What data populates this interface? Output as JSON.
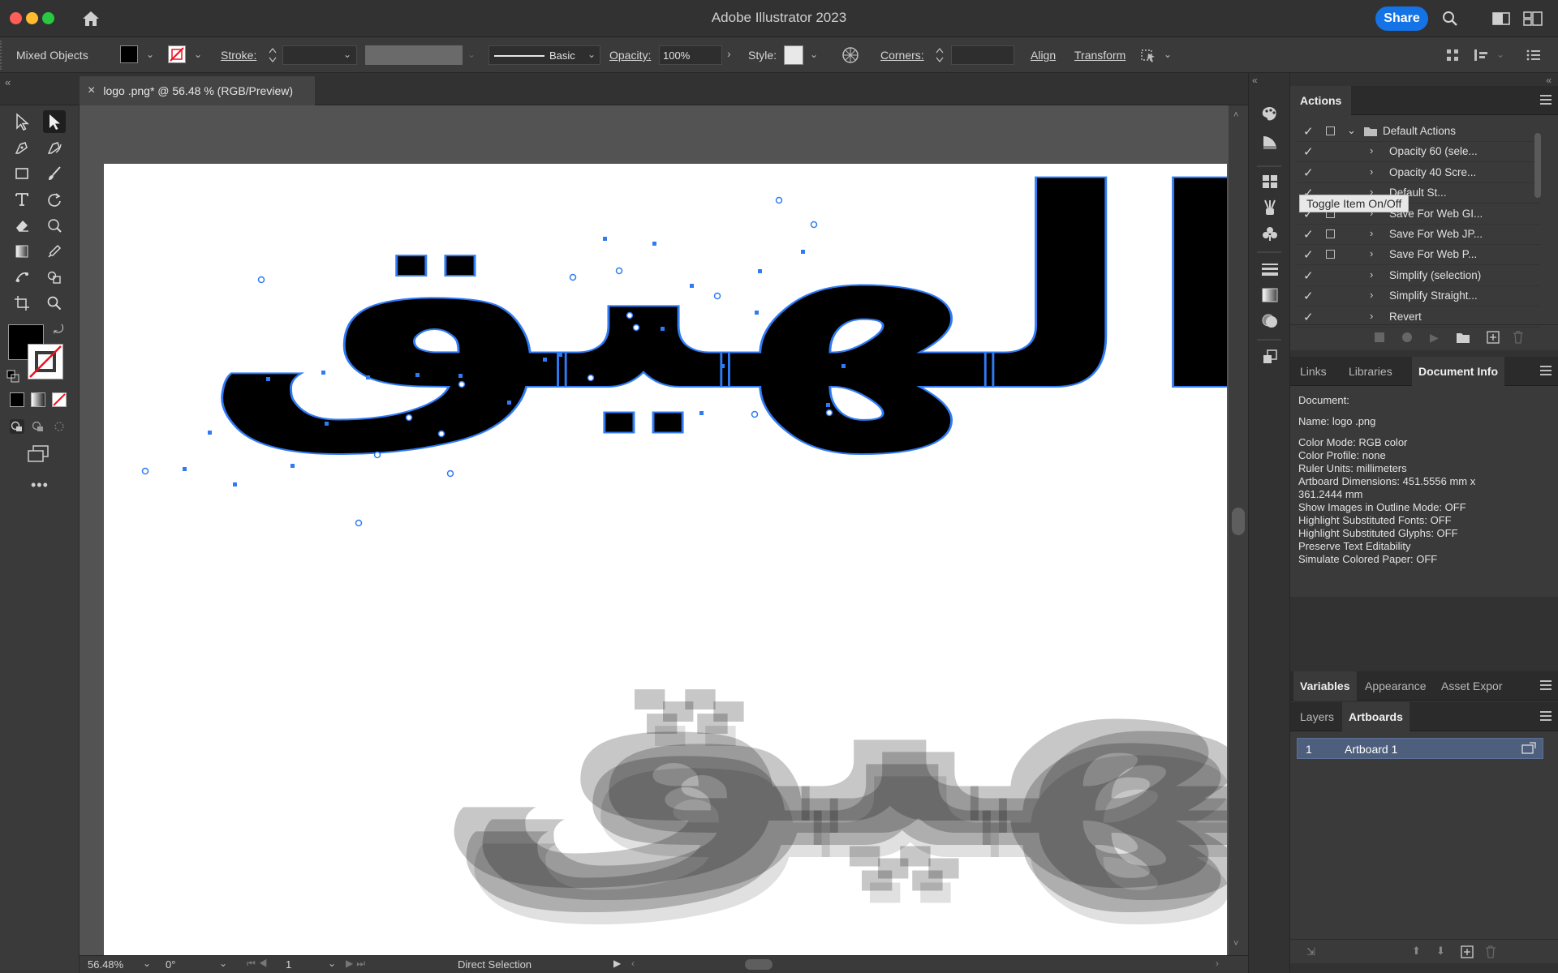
{
  "app": {
    "title": "Adobe Illustrator 2023",
    "share_label": "Share"
  },
  "control_bar": {
    "selection_label": "Mixed Objects",
    "stroke_label": "Stroke:",
    "stroke_profile": "Basic",
    "opacity_label": "Opacity:",
    "opacity_value": "100%",
    "style_label": "Style:",
    "corners_label": "Corners:",
    "align_label": "Align",
    "transform_label": "Transform"
  },
  "document_tab": {
    "title": "logo .png* @ 56.48 % (RGB/Preview)",
    "close": "×"
  },
  "canvas": {
    "artwork_text": "الهيق"
  },
  "status_bar": {
    "zoom": "56.48%",
    "rotation": "0°",
    "artboard_number": "1",
    "tool_name": "Direct Selection"
  },
  "actions_panel": {
    "tab": "Actions",
    "tooltip": "Toggle Item On/Off",
    "rows": [
      {
        "name": "Default Actions",
        "level": 0,
        "expanded": true
      },
      {
        "name": "Opacity 60 (sele...",
        "level": 1
      },
      {
        "name": "Opacity 40 Scre...",
        "level": 1
      },
      {
        "name": "Default St...",
        "level": 1
      },
      {
        "name": "Save For Web GI...",
        "level": 1
      },
      {
        "name": "Save For Web JP...",
        "level": 1
      },
      {
        "name": "Save For Web P...",
        "level": 1
      },
      {
        "name": "Simplify (selection)",
        "level": 1
      },
      {
        "name": "Simplify Straight...",
        "level": 1
      },
      {
        "name": "Revert",
        "level": 1
      }
    ]
  },
  "info_panel": {
    "tabs": [
      "Links",
      "Libraries",
      "Document Info"
    ],
    "active_tab": "Document Info",
    "lines": [
      "Document:",
      "",
      "Name: logo .png",
      "",
      "Color Mode: RGB color",
      "Color Profile: none",
      "Ruler Units: millimeters",
      "Artboard Dimensions: 451.5556 mm x",
      "361.2444 mm",
      "Show Images in Outline Mode: OFF",
      "Highlight Substituted Fonts: OFF",
      "Highlight Substituted Glyphs: OFF",
      "Preserve Text Editability",
      "Simulate Colored Paper: OFF"
    ]
  },
  "variables_panel": {
    "tabs": [
      "Variables",
      "Appearance",
      "Asset Expor"
    ],
    "active_tab": "Variables"
  },
  "artboards_panel": {
    "tabs": [
      "Layers",
      "Artboards"
    ],
    "active_tab": "Artboards",
    "rows": [
      {
        "index": "1",
        "name": "Artboard 1"
      }
    ]
  },
  "colors": {
    "accent": "#1473e6",
    "selection": "#2f7bf5",
    "panel_bg": "#323232",
    "canvas_bg": "#535353"
  }
}
